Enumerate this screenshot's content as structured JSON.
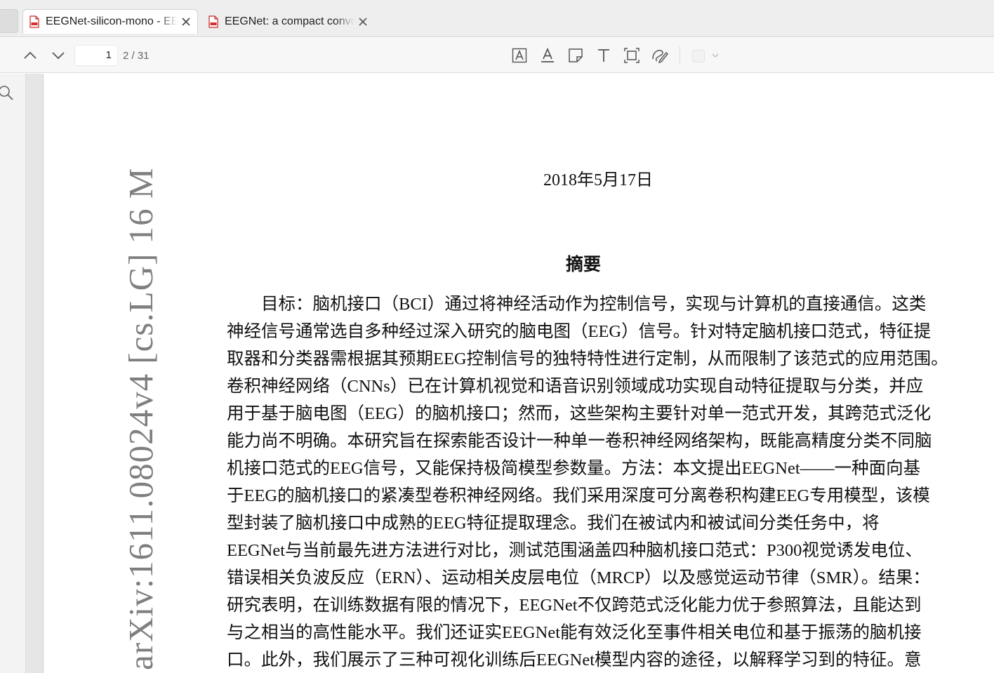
{
  "tabs": [
    {
      "title": "EEGNet-silicon-mono - EEGNet-silicon-mono.pdf",
      "active": true,
      "icon": "pdf-file-icon"
    },
    {
      "title": "EEGNet: a compact convolutional neural network",
      "active": false,
      "icon": "pdf-file-icon"
    }
  ],
  "toolbar": {
    "current_page": "1",
    "page_total": "2 / 31",
    "tools": [
      "prev-page-icon",
      "next-page-icon",
      "area-text-icon",
      "text-underline-icon",
      "note-icon",
      "text-tool-icon",
      "select-area-icon",
      "draw-icon"
    ]
  },
  "document": {
    "arxiv_stamp": "arXiv:1611.08024v4  [cs.LG]  16 M",
    "date": "2018年5月17日",
    "heading": "摘要",
    "abstract_lines": [
      "　　目标：脑机接口（BCI）通过将神经活动作为控制信号，实现与计算机的直接通信。这类",
      "神经信号通常选自多种经过深入研究的脑电图（EEG）信号。针对特定脑机接口范式，特征提",
      "取器和分类器需根据其预期EEG控制信号的独特特性进行定制，从而限制了该范式的应用范围。",
      "卷积神经网络（CNNs）已在计算机视觉和语音识别领域成功实现自动特征提取与分类，并应",
      "用于基于脑电图（EEG）的脑机接口；然而，这些架构主要针对单一范式开发，其跨范式泛化",
      "能力尚不明确。本研究旨在探索能否设计一种单一卷积神经网络架构，既能高精度分类不同脑",
      "机接口范式的EEG信号，又能保持极简模型参数量。方法：本文提出EEGNet——一种面向基",
      "于EEG的脑机接口的紧凑型卷积神经网络。我们采用深度可分离卷积构建EEG专用模型，该模",
      "型封装了脑机接口中成熟的EEG特征提取理念。我们在被试内和被试间分类任务中，将",
      "EEGNet与当前最先进方法进行对比，测试范围涵盖四种脑机接口范式：P300视觉诱发电位、",
      "错误相关负波反应（ERN）、运动相关皮层电位（MRCP）以及感觉运动节律（SMR）。结果：",
      "研究表明，在训练数据有限的情况下，EEGNet不仅跨范式泛化能力优于参照算法，且能达到",
      "与之相当的高性能水平。我们还证实EEGNet能有效泛化至事件相关电位和基于振荡的脑机接",
      "口。此外，我们展示了三种可视化训练后EEGNet模型内容的途径，以解释学习到的特征。意"
    ]
  }
}
